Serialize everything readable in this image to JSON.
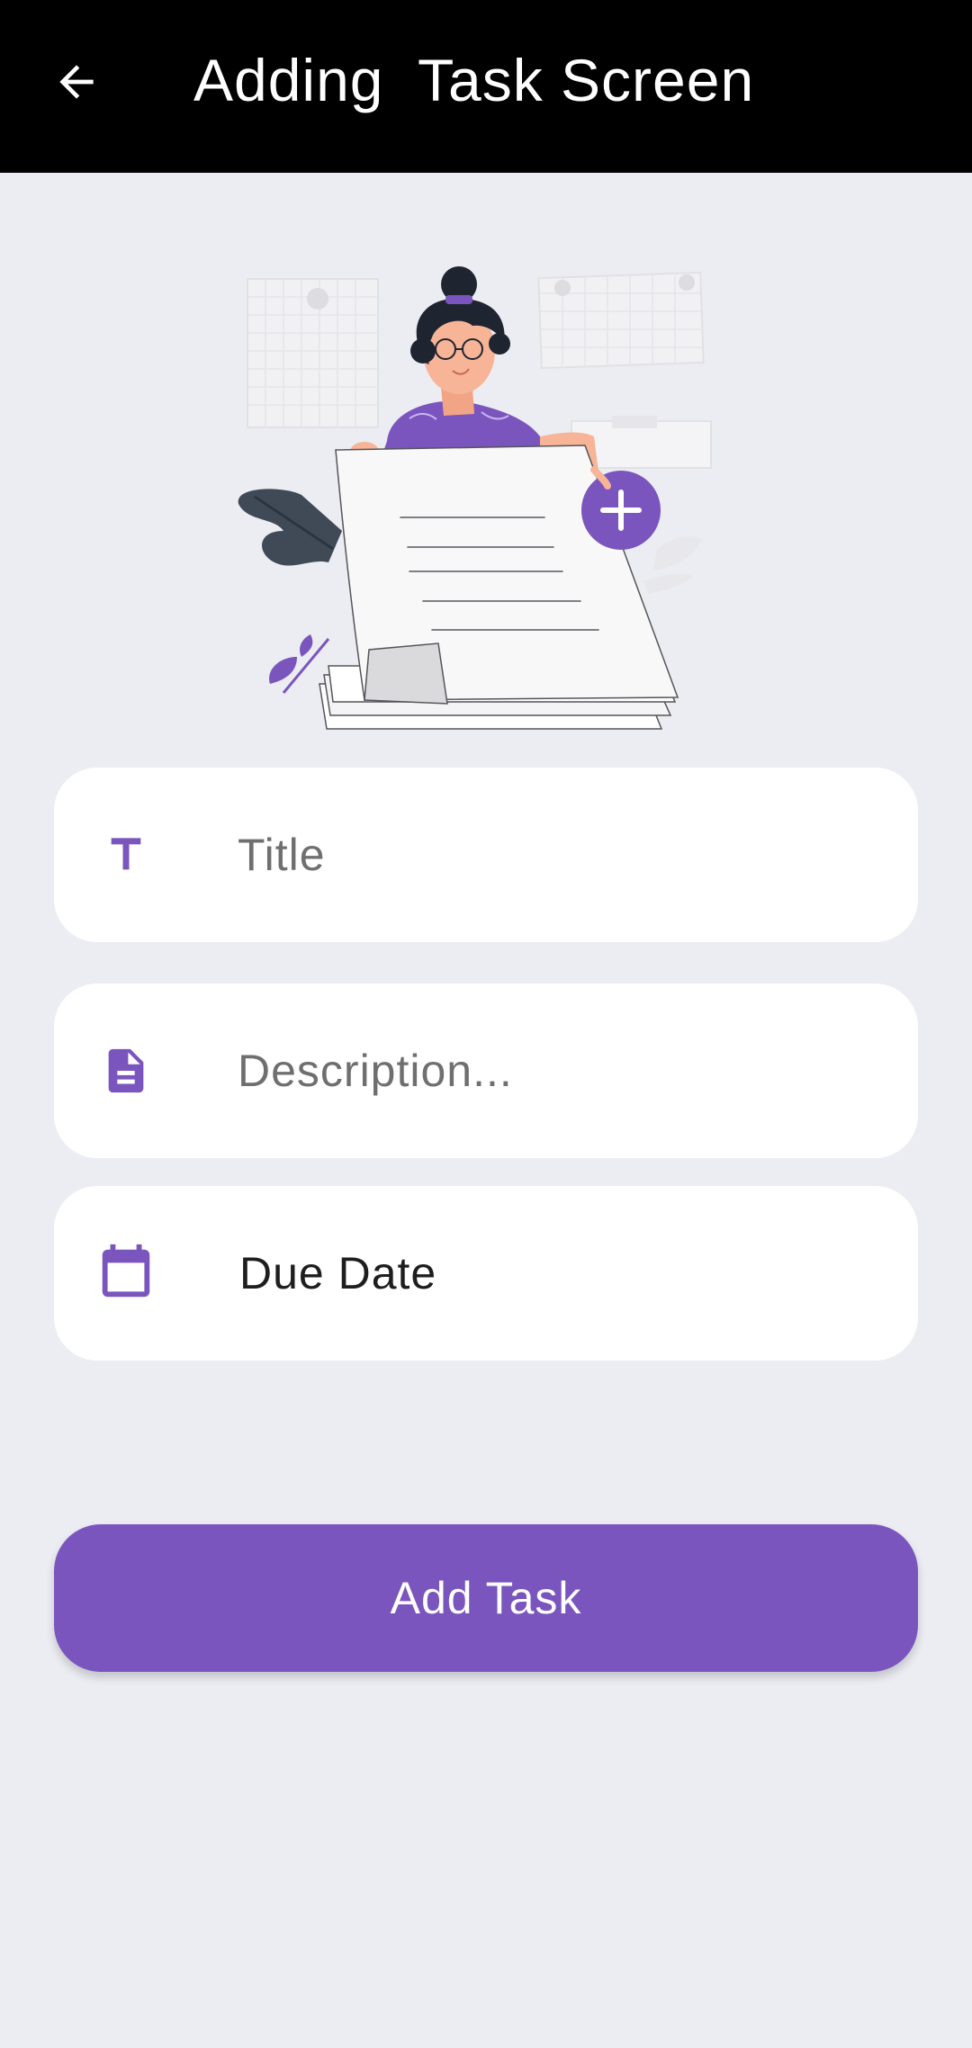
{
  "header": {
    "title": "Adding  Task Screen",
    "back_icon": "arrow-left-icon"
  },
  "illustration": {
    "name": "woman-holding-task-sheet-illustration",
    "plus_icon": "plus-icon"
  },
  "form": {
    "title_field": {
      "placeholder": "Title",
      "value": "",
      "icon": "text-t-icon"
    },
    "description_field": {
      "placeholder": "Description...",
      "value": "",
      "icon": "document-icon"
    },
    "due_date_field": {
      "label": "Due Date",
      "icon": "calendar-icon"
    }
  },
  "actions": {
    "add_task_label": "Add Task"
  },
  "colors": {
    "appbar": "#000000",
    "background": "#ECEDF3",
    "accent": "#7B55BE",
    "field_bg": "#FFFFFF",
    "placeholder": "#6F6F6F"
  }
}
